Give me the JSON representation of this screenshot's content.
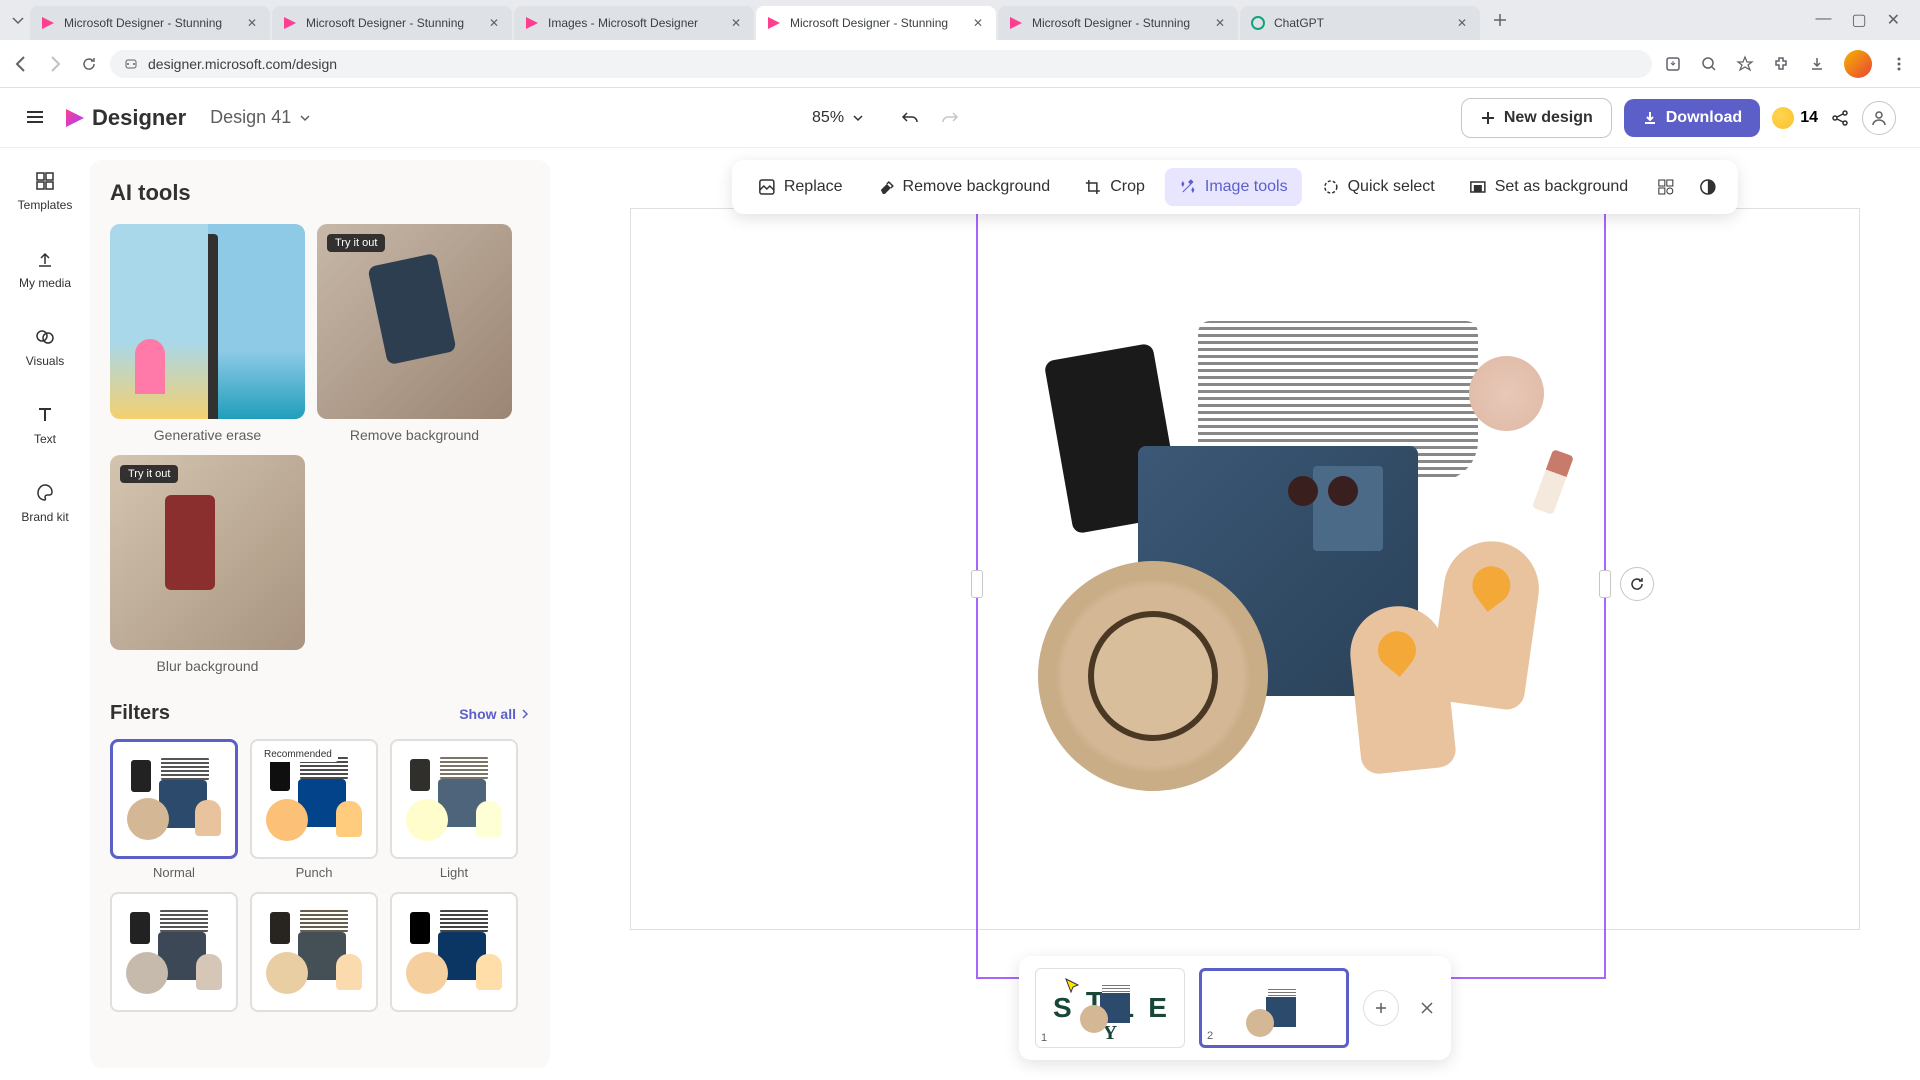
{
  "browser": {
    "tabs": [
      {
        "title": "Microsoft Designer - Stunning"
      },
      {
        "title": "Microsoft Designer - Stunning"
      },
      {
        "title": "Images - Microsoft Designer"
      },
      {
        "title": "Microsoft Designer - Stunning"
      },
      {
        "title": "Microsoft Designer - Stunning"
      },
      {
        "title": "ChatGPT"
      }
    ],
    "active_tab_index": 3,
    "url": "designer.microsoft.com/design"
  },
  "header": {
    "logo_text": "Designer",
    "design_title": "Design 41",
    "zoom": "85%",
    "new_design_label": "New design",
    "download_label": "Download",
    "credits": "14"
  },
  "rail": {
    "items": [
      {
        "icon": "templates",
        "label": "Templates"
      },
      {
        "icon": "upload",
        "label": "My media"
      },
      {
        "icon": "visuals",
        "label": "Visuals"
      },
      {
        "icon": "text",
        "label": "Text"
      },
      {
        "icon": "brandkit",
        "label": "Brand kit"
      }
    ]
  },
  "panel": {
    "ai_heading": "AI tools",
    "try_badge": "Try it out",
    "ai_tools": [
      {
        "label": "Generative erase"
      },
      {
        "label": "Remove background"
      },
      {
        "label": "Blur background"
      }
    ],
    "filters_heading": "Filters",
    "show_all": "Show all",
    "recommended_badge": "Recommended",
    "filters": [
      {
        "label": "Normal"
      },
      {
        "label": "Punch"
      },
      {
        "label": "Light"
      }
    ]
  },
  "ctx_toolbar": {
    "replace": "Replace",
    "remove_bg": "Remove background",
    "crop": "Crop",
    "image_tools": "Image tools",
    "quick_select": "Quick select",
    "set_bg": "Set as background"
  },
  "pages": {
    "page1_num": "1",
    "page2_num": "2",
    "page1_letters": [
      "S",
      "T",
      "L",
      "E",
      "Y"
    ]
  },
  "colors": {
    "accent": "#5b5fc7",
    "selection": "#a864ff"
  }
}
